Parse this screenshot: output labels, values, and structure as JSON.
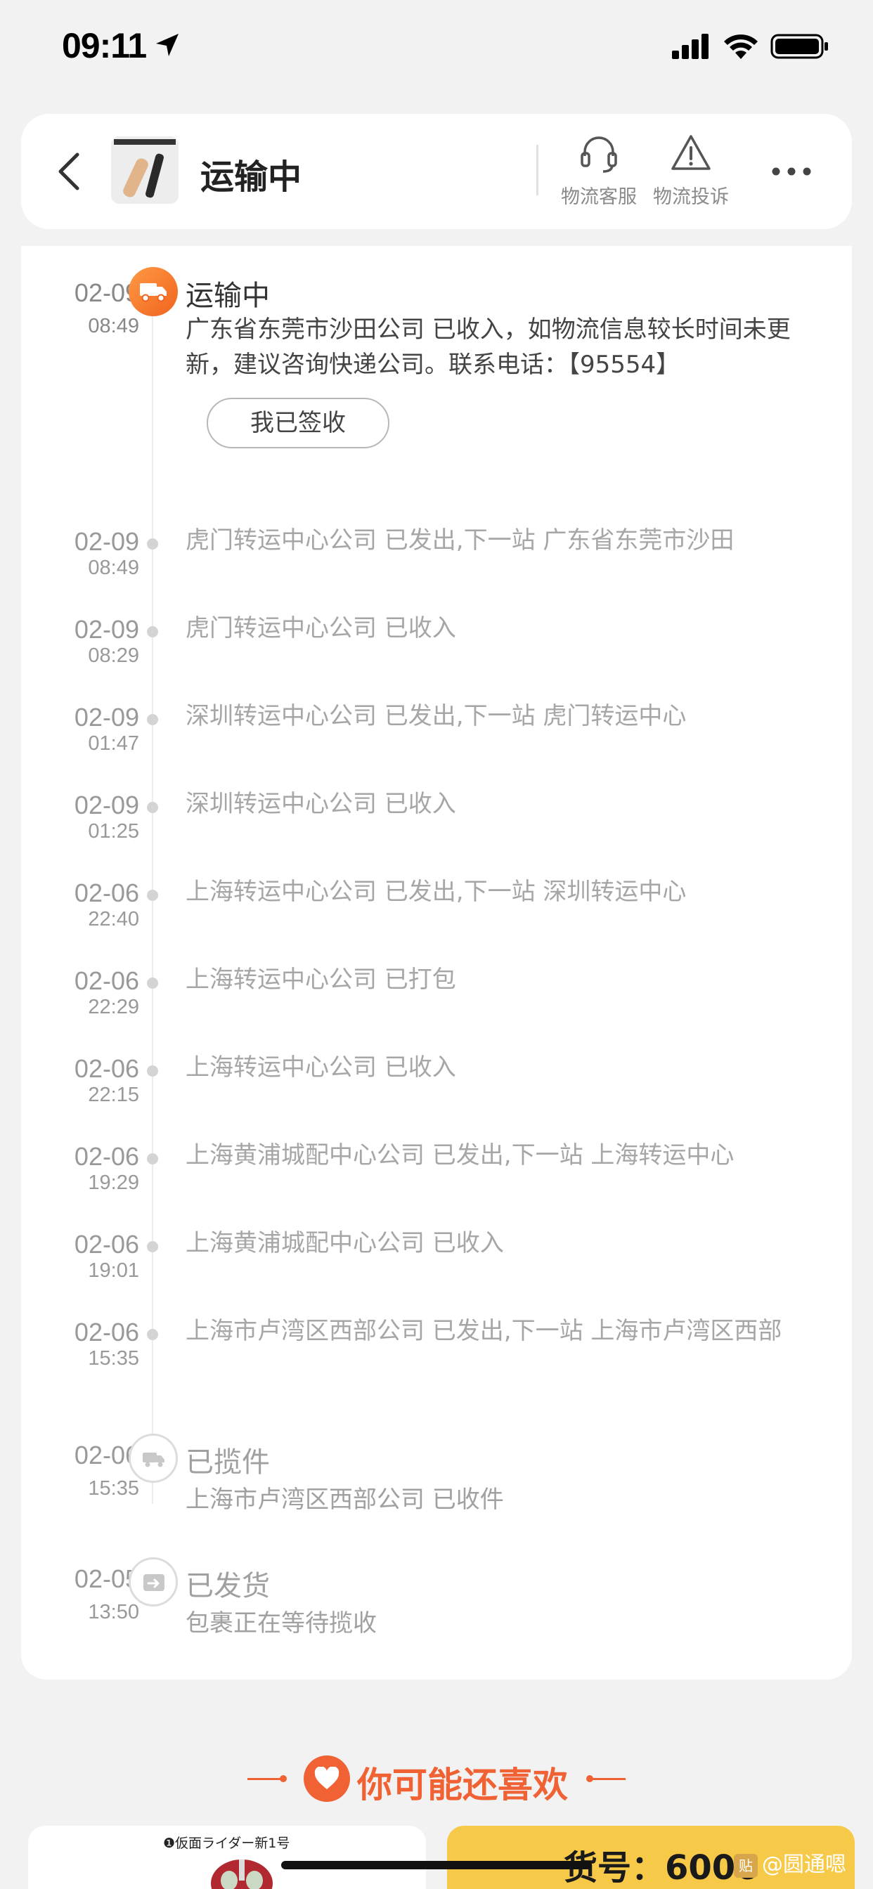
{
  "status_bar": {
    "time": "09:11"
  },
  "header": {
    "title": "运输中",
    "actions": [
      {
        "label": "物流客服",
        "icon": "headset-icon"
      },
      {
        "label": "物流投诉",
        "icon": "warning-icon"
      }
    ],
    "more_icon": "more-icon",
    "back_icon": "back-icon"
  },
  "timeline": {
    "current": {
      "date": "02-09",
      "time": "08:49",
      "status": "运输中",
      "detail": "广东省东莞市沙田公司 已收入，如物流信息较长时间未更新，建议咨询快递公司。联系电话：【95554】",
      "sign_button": "我已签收"
    },
    "events": [
      {
        "date": "02-09",
        "time": "08:49",
        "text": "虎门转运中心公司 已发出,下一站 广东省东莞市沙田"
      },
      {
        "date": "02-09",
        "time": "08:29",
        "text": "虎门转运中心公司 已收入"
      },
      {
        "date": "02-09",
        "time": "01:47",
        "text": "深圳转运中心公司 已发出,下一站 虎门转运中心"
      },
      {
        "date": "02-09",
        "time": "01:25",
        "text": "深圳转运中心公司 已收入"
      },
      {
        "date": "02-06",
        "time": "22:40",
        "text": "上海转运中心公司 已发出,下一站 深圳转运中心"
      },
      {
        "date": "02-06",
        "time": "22:29",
        "text": "上海转运中心公司 已打包"
      },
      {
        "date": "02-06",
        "time": "22:15",
        "text": "上海转运中心公司 已收入"
      },
      {
        "date": "02-06",
        "time": "19:29",
        "text": "上海黄浦城配中心公司 已发出,下一站 上海转运中心"
      },
      {
        "date": "02-06",
        "time": "19:01",
        "text": "上海黄浦城配中心公司 已收入"
      },
      {
        "date": "02-06",
        "time": "15:35",
        "text": "上海市卢湾区西部公司 已发出,下一站 上海市卢湾区西部"
      }
    ],
    "milestones": [
      {
        "date": "02-06",
        "time": "15:35",
        "title": "已揽件",
        "desc": "上海市卢湾区西部公司 已收件"
      },
      {
        "date": "02-05",
        "time": "13:50",
        "title": "已发货",
        "desc": "包裹正在等待揽收"
      }
    ]
  },
  "recommendations": {
    "title": "你可能还喜欢",
    "left_caption": "❶仮面ライダー新1号",
    "right_code": "货号：6006",
    "watermark": "@圆通嗯",
    "watermark_badge": "贴"
  },
  "colors": {
    "accent": "#f06234",
    "badge_active": "#f0631e",
    "right_card": "#f7c948"
  }
}
